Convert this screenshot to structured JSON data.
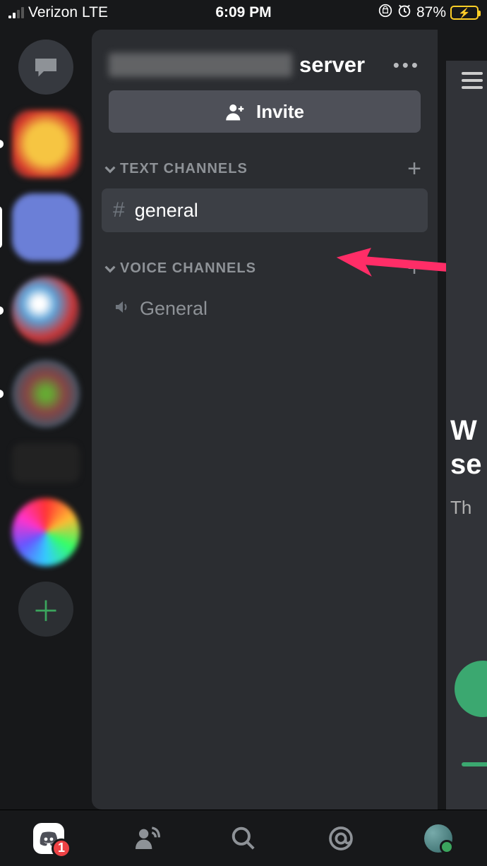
{
  "status": {
    "carrier": "Verizon",
    "network": "LTE",
    "time": "6:09 PM",
    "battery_pct": "87%"
  },
  "server": {
    "name_suffix": "server",
    "more_menu": "•••"
  },
  "invite": {
    "label": "Invite"
  },
  "categories": {
    "text": {
      "label": "TEXT CHANNELS"
    },
    "voice": {
      "label": "VOICE CHANNELS"
    }
  },
  "channels": {
    "text_general": "general",
    "voice_general": "General"
  },
  "tabbar": {
    "badge": "1"
  },
  "peek": {
    "line1": "W",
    "line2": "se",
    "sub": "Th"
  }
}
